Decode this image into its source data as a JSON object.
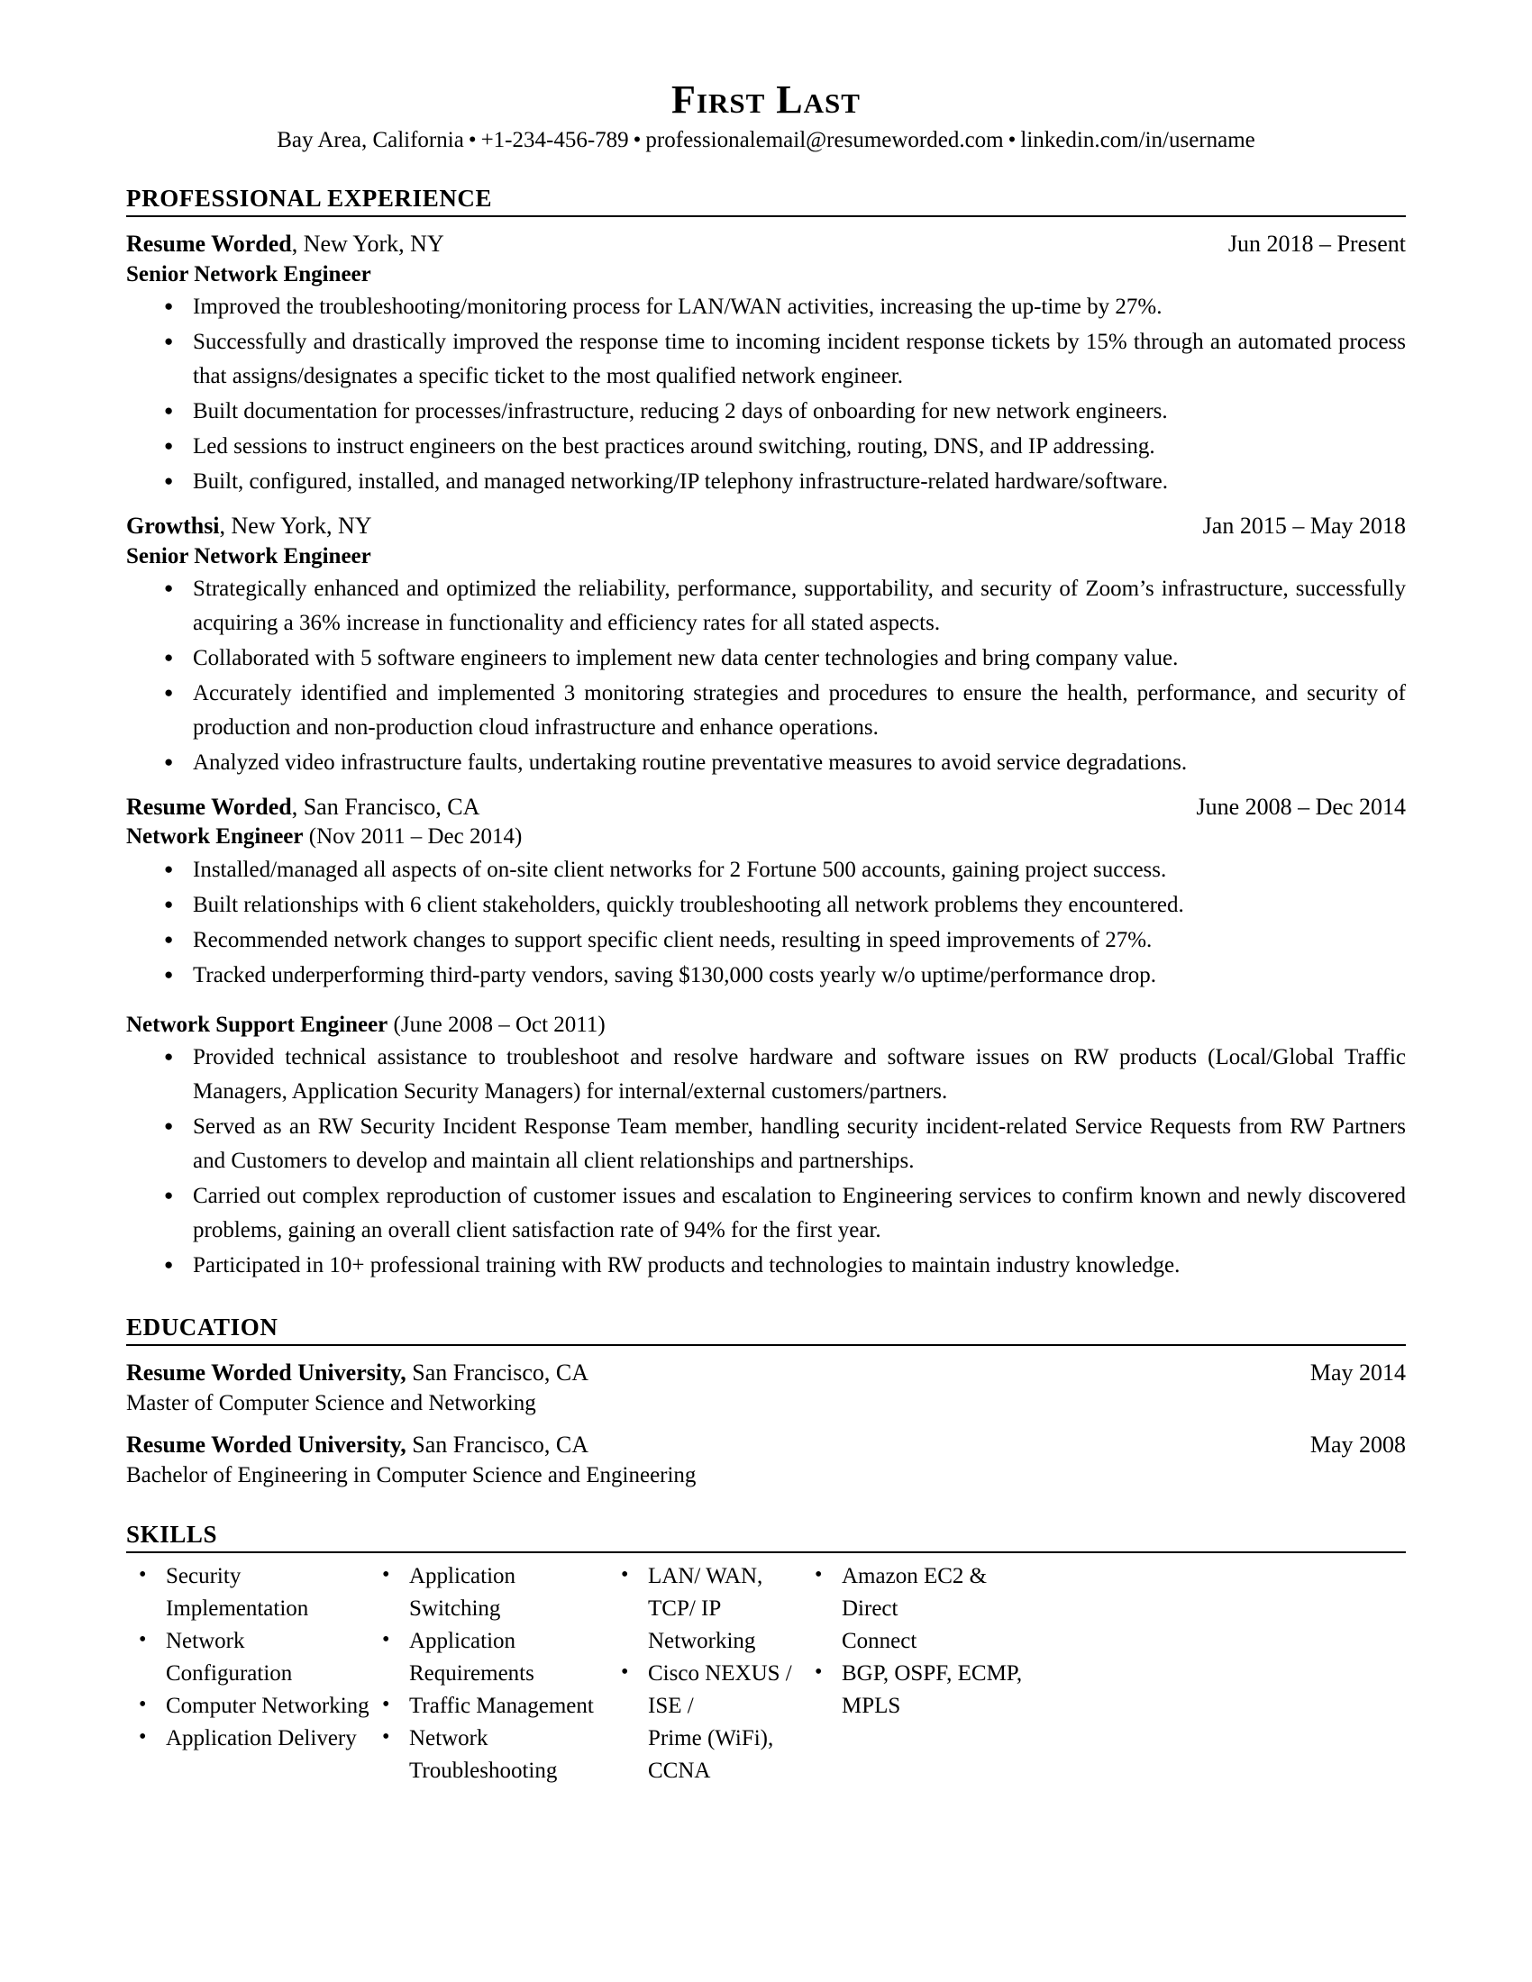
{
  "header": {
    "name": "First Last",
    "contact": {
      "location": "Bay Area, California",
      "phone": "+1-234-456-789",
      "email": "professionalemail@resumeworded.com",
      "linkedin": "linkedin.com/in/username",
      "separator": "•"
    }
  },
  "sections": {
    "experience": {
      "title": "PROFESSIONAL EXPERIENCE",
      "entries": [
        {
          "org_name": "Resume Worded",
          "org_location": ", New York, NY",
          "dates": "Jun 2018 – Present",
          "role": "Senior Network Engineer",
          "role_dates": "",
          "bullets": [
            "Improved the troubleshooting/monitoring process for LAN/WAN activities, increasing the up-time by 27%.",
            "Successfully and drastically improved the response time to incoming incident response tickets by 15% through an automated process that assigns/designates a specific ticket to the most qualified network engineer.",
            "Built documentation for processes/infrastructure, reducing 2 days of onboarding for new network engineers.",
            "Led sessions to instruct engineers on the best practices around switching, routing, DNS, and IP addressing.",
            "Built, configured, installed, and managed networking/IP telephony infrastructure-related hardware/software."
          ]
        },
        {
          "org_name": "Growthsi",
          "org_location": ", New York, NY",
          "dates": "Jan 2015 – May 2018",
          "role": "Senior Network Engineer",
          "role_dates": "",
          "bullets": [
            "Strategically enhanced and optimized the reliability, performance, supportability, and security of Zoom’s infrastructure, successfully acquiring a 36% increase in functionality and efficiency rates for all stated aspects.",
            "Collaborated with 5 software engineers to implement new data center technologies and bring company value.",
            "Accurately identified and implemented 3 monitoring strategies and procedures to ensure the health, performance, and security of production and non-production cloud infrastructure and enhance operations.",
            "Analyzed video infrastructure faults, undertaking routine preventative measures to avoid service degradations."
          ]
        },
        {
          "org_name": "Resume Worded",
          "org_location": ", San Francisco, CA",
          "dates": "June 2008 – Dec 2014",
          "role": "Network Engineer",
          "role_dates": " (Nov 2011 – Dec 2014)",
          "bullets": [
            "Installed/managed all aspects of on-site client networks for 2 Fortune 500 accounts, gaining project success.",
            "Built relationships with 6 client stakeholders, quickly troubleshooting all network problems they encountered.",
            "Recommended network changes to support specific client needs, resulting in speed improvements of 27%.",
            "Tracked underperforming third-party vendors, saving $130,000 costs yearly w/o uptime/performance drop."
          ]
        }
      ],
      "sub_entry": {
        "role": "Network Support Engineer",
        "role_dates": " (June 2008 – Oct 2011)",
        "bullets": [
          "Provided technical assistance to troubleshoot and resolve hardware and software issues on RW products (Local/Global Traffic Managers, Application Security Managers) for internal/external customers/partners.",
          "Served as an RW Security Incident Response Team member, handling security incident-related Service Requests from RW Partners and Customers to develop and maintain all client relationships and partnerships.",
          "Carried out complex reproduction of customer issues and escalation to Engineering services to confirm known and newly discovered problems, gaining an overall client satisfaction rate of 94% for the first year.",
          "Participated in 10+ professional training with RW products and technologies to maintain industry knowledge."
        ]
      }
    },
    "education": {
      "title": "EDUCATION",
      "entries": [
        {
          "school": "Resume Worded University,",
          "location": " San Francisco, CA",
          "date": "May 2014",
          "degree": "Master of Computer Science and Networking"
        },
        {
          "school": "Resume Worded University,",
          "location": " San Francisco, CA",
          "date": "May 2008",
          "degree": "Bachelor of Engineering in Computer Science and Engineering"
        }
      ]
    },
    "skills": {
      "title": "SKILLS",
      "columns": [
        {
          "items": [
            {
              "text": "Security Implementation",
              "continuation": false
            },
            {
              "text": "Network Configuration",
              "continuation": false
            },
            {
              "text": "Computer Networking",
              "continuation": false
            },
            {
              "text": "Application Delivery",
              "continuation": false
            }
          ]
        },
        {
          "items": [
            {
              "text": "Application Switching",
              "continuation": false
            },
            {
              "text": "Application Requirements",
              "continuation": false
            },
            {
              "text": "Traffic Management",
              "continuation": false
            },
            {
              "text": "Network Troubleshooting",
              "continuation": false
            }
          ]
        },
        {
          "items": [
            {
              "text": "LAN/ WAN, TCP/ IP",
              "continuation": false
            },
            {
              "text": "Networking",
              "continuation": true
            },
            {
              "text": "Cisco NEXUS / ISE /",
              "continuation": false
            },
            {
              "text": "Prime (WiFi), CCNA",
              "continuation": true
            }
          ]
        },
        {
          "items": [
            {
              "text": "Amazon EC2 & Direct",
              "continuation": false
            },
            {
              "text": "Connect",
              "continuation": true
            },
            {
              "text": "BGP, OSPF, ECMP,",
              "continuation": false
            },
            {
              "text": "MPLS",
              "continuation": true
            }
          ]
        }
      ]
    }
  },
  "colors": {
    "text": "#000000",
    "background": "#ffffff",
    "rule": "#000000"
  }
}
